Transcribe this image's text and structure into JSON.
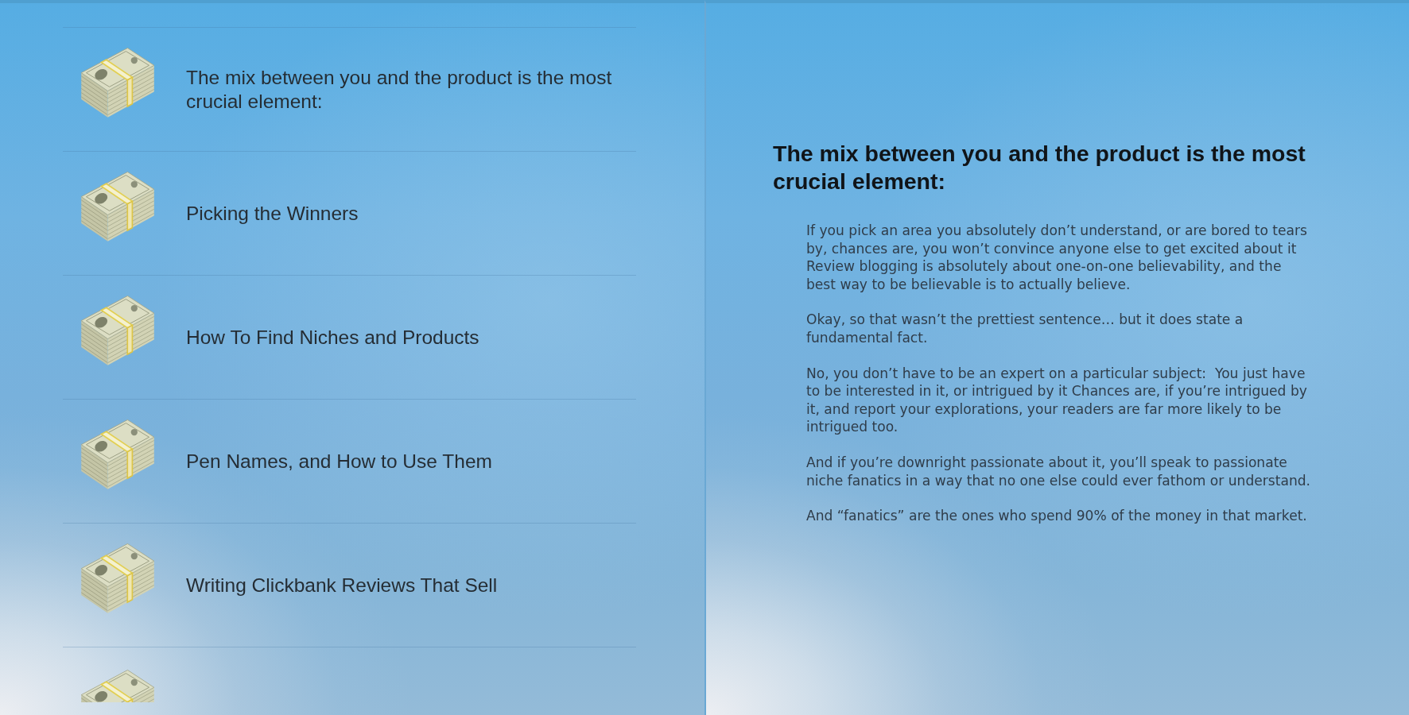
{
  "list": {
    "items": [
      {
        "kind": "entry",
        "title": "The mix between you and the product is the most crucial element:"
      },
      {
        "kind": "entry",
        "title": "Picking the Winners"
      },
      {
        "kind": "entry",
        "title": "How To Find Niches and Products"
      },
      {
        "kind": "entry",
        "title": "Pen Names, and How to Use Them"
      },
      {
        "kind": "entry",
        "title": "Writing Clickbank Reviews That Sell"
      },
      {
        "kind": "cut_off"
      }
    ]
  },
  "article": {
    "heading": "The mix between you and the product is the most crucial element:",
    "paragraphs": [
      "If you pick an area you absolutely don’t understand, or are bored to tears by, chances are, you won’t convince anyone else to get excited about it\nReview blogging is absolutely about one-on-one believability, and the best way to be believable is to actually believe.",
      "Okay, so that wasn’t the prettiest sentence… but it does state a fundamental fact.",
      "No, you don’t have to be an expert on a particular subject:  You just have to be interested in it, or intrigued by it Chances are, if you’re intrigued by it, and report your explorations, your readers are far more likely to be intrigued too.",
      "And if you’re downright passionate about it, you’ll speak to passionate niche fanatics in a way that no one else could ever fathom or understand.",
      "And “fanatics” are the ones who spend 90% of the money in that market."
    ]
  }
}
